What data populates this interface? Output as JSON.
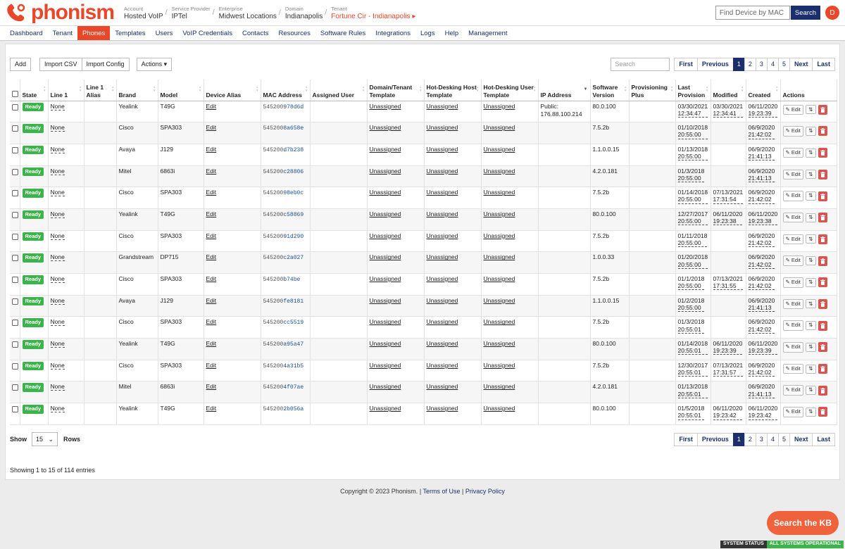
{
  "header": {
    "logo_text": "phonism",
    "crumbs": [
      {
        "label": "Account",
        "value": "Hosted VoIP"
      },
      {
        "label": "Service Provider",
        "value": "IPTel"
      },
      {
        "label": "Enterprise",
        "value": "Midwest Locations"
      },
      {
        "label": "Domain",
        "value": "Indianapolis"
      },
      {
        "label": "Tenant",
        "value": "Fortune Cir - Indianapolis"
      }
    ],
    "mac_placeholder": "Find Device by MAC",
    "search_label": "Search",
    "avatar_letter": "D"
  },
  "nav": [
    "Dashboard",
    "Tenant",
    "Phones",
    "Templates",
    "Users",
    "VoIP Credentials",
    "Contacts",
    "Resources",
    "Software Rules",
    "Integrations",
    "Logs",
    "Help",
    "Management"
  ],
  "toolbar": {
    "add": "Add",
    "import_csv": "Import CSV",
    "import_config": "Import Config",
    "actions": "Actions",
    "search_placeholder": "Search"
  },
  "pager": {
    "first": "First",
    "previous": "Previous",
    "pages": [
      "1",
      "2",
      "3",
      "4",
      "5"
    ],
    "next": "Next",
    "last": "Last"
  },
  "columns": [
    "State",
    "Line 1",
    "Line 1 Alias",
    "Brand",
    "Model",
    "Device Alias",
    "MAC Address",
    "Assigned User",
    "Domain/Tenant Template",
    "Hot-Desking Host Template",
    "Hot-Desking User Template",
    "IP Address",
    "Software Version",
    "Provisioning Plus",
    "Last Provision",
    "Modified",
    "Created",
    "Actions"
  ],
  "rows": [
    {
      "state": "Ready",
      "line1": "None",
      "brand": "Yealink",
      "model": "T49G",
      "alias": "Edit",
      "mac_pre": "545200",
      "mac_post": "978d6d",
      "tmpl": "Unassigned",
      "hd_host": "Unassigned",
      "hd_user": "Unassigned",
      "ip1": "Public:",
      "ip2": "176.88.100.214",
      "sw": "80.0.100",
      "lp_d": "03/30/2021",
      "lp_t": "12:34:47",
      "mod_d": "03/30/2021",
      "mod_t": "12:34:41",
      "cr_d": "06/11/2020",
      "cr_t": "19:23:39"
    },
    {
      "state": "Ready",
      "line1": "None",
      "brand": "Cisco",
      "model": "SPA303",
      "alias": "Edit",
      "mac_pre": "545200",
      "mac_post": "8a658e",
      "tmpl": "Unassigned",
      "hd_host": "Unassigned",
      "hd_user": "Unassigned",
      "ip1": "",
      "ip2": "",
      "sw": "7.5.2b",
      "lp_d": "01/10/2018",
      "lp_t": "20:55:00",
      "mod_d": "",
      "mod_t": "",
      "cr_d": "06/9/2020",
      "cr_t": "21:42:02"
    },
    {
      "state": "Ready",
      "line1": "None",
      "brand": "Avaya",
      "model": "J129",
      "alias": "Edit",
      "mac_pre": "545200",
      "mac_post": "d7b238",
      "tmpl": "Unassigned",
      "hd_host": "Unassigned",
      "hd_user": "Unassigned",
      "ip1": "",
      "ip2": "",
      "sw": "1.1.0.0.15",
      "lp_d": "01/13/2018",
      "lp_t": "20:55:00",
      "mod_d": "",
      "mod_t": "",
      "cr_d": "06/9/2020",
      "cr_t": "21:41:13"
    },
    {
      "state": "Ready",
      "line1": "None",
      "brand": "Mitel",
      "model": "6863i",
      "alias": "Edit",
      "mac_pre": "545200",
      "mac_post": "c28806",
      "tmpl": "Unassigned",
      "hd_host": "Unassigned",
      "hd_user": "Unassigned",
      "ip1": "",
      "ip2": "",
      "sw": "4.2.0.181",
      "lp_d": "01/3/2018",
      "lp_t": "20:55:00",
      "mod_d": "",
      "mod_t": "",
      "cr_d": "06/9/2020",
      "cr_t": "21:41:13"
    },
    {
      "state": "Ready",
      "line1": "None",
      "brand": "Cisco",
      "model": "SPA303",
      "alias": "Edit",
      "mac_pre": "545200",
      "mac_post": "98eb0c",
      "tmpl": "Unassigned",
      "hd_host": "Unassigned",
      "hd_user": "Unassigned",
      "ip1": "",
      "ip2": "",
      "sw": "7.5.2b",
      "lp_d": "01/14/2018",
      "lp_t": "20:55:00",
      "mod_d": "07/13/2021",
      "mod_t": "17:31:54",
      "cr_d": "06/9/2020",
      "cr_t": "21:42:02"
    },
    {
      "state": "Ready",
      "line1": "None",
      "brand": "Yealink",
      "model": "T49G",
      "alias": "Edit",
      "mac_pre": "545200",
      "mac_post": "c58869",
      "tmpl": "Unassigned",
      "hd_host": "Unassigned",
      "hd_user": "Unassigned",
      "ip1": "",
      "ip2": "",
      "sw": "80.0.100",
      "lp_d": "12/27/2017",
      "lp_t": "20:55:00",
      "mod_d": "06/11/2020",
      "mod_t": "19:23:38",
      "cr_d": "06/11/2020",
      "cr_t": "19:23:38"
    },
    {
      "state": "Ready",
      "line1": "None",
      "brand": "Cisco",
      "model": "SPA303",
      "alias": "Edit",
      "mac_pre": "545200",
      "mac_post": "91d290",
      "tmpl": "Unassigned",
      "hd_host": "Unassigned",
      "hd_user": "Unassigned",
      "ip1": "",
      "ip2": "",
      "sw": "7.5.2b",
      "lp_d": "01/11/2018",
      "lp_t": "20:55:00",
      "mod_d": "",
      "mod_t": "",
      "cr_d": "06/9/2020",
      "cr_t": "21:42:02"
    },
    {
      "state": "Ready",
      "line1": "None",
      "brand": "Grandstream",
      "model": "DP715",
      "alias": "Edit",
      "mac_pre": "545200",
      "mac_post": "c2a027",
      "tmpl": "Unassigned",
      "hd_host": "Unassigned",
      "hd_user": "Unassigned",
      "ip1": "",
      "ip2": "",
      "sw": "1.0.0.33",
      "lp_d": "01/20/2018",
      "lp_t": "20:55:00",
      "mod_d": "",
      "mod_t": "",
      "cr_d": "06/9/2020",
      "cr_t": "21:42:02"
    },
    {
      "state": "Ready",
      "line1": "None",
      "brand": "Cisco",
      "model": "SPA303",
      "alias": "Edit",
      "mac_pre": "545200",
      "mac_post": "b74be",
      "tmpl": "Unassigned",
      "hd_host": "Unassigned",
      "hd_user": "Unassigned",
      "ip1": "",
      "ip2": "",
      "sw": "7.5.2b",
      "lp_d": "01/1/2018",
      "lp_t": "20:55:00",
      "mod_d": "07/13/2021",
      "mod_t": "17:31:55",
      "cr_d": "06/9/2020",
      "cr_t": "21:42:02"
    },
    {
      "state": "Ready",
      "line1": "None",
      "brand": "Avaya",
      "model": "J129",
      "alias": "Edit",
      "mac_pre": "545200",
      "mac_post": "fe8181",
      "tmpl": "Unassigned",
      "hd_host": "Unassigned",
      "hd_user": "Unassigned",
      "ip1": "",
      "ip2": "",
      "sw": "1.1.0.0.15",
      "lp_d": "01/2/2018",
      "lp_t": "20:55:00",
      "mod_d": "",
      "mod_t": "",
      "cr_d": "06/9/2020",
      "cr_t": "21:41:13"
    },
    {
      "state": "Ready",
      "line1": "None",
      "brand": "Cisco",
      "model": "SPA303",
      "alias": "Edit",
      "mac_pre": "545200",
      "mac_post": "cc5519",
      "tmpl": "Unassigned",
      "hd_host": "Unassigned",
      "hd_user": "Unassigned",
      "ip1": "",
      "ip2": "",
      "sw": "7.5.2b",
      "lp_d": "01/3/2018",
      "lp_t": "20:55:01",
      "mod_d": "",
      "mod_t": "",
      "cr_d": "06/9/2020",
      "cr_t": "21:42:02"
    },
    {
      "state": "Ready",
      "line1": "None",
      "brand": "Yealink",
      "model": "T49G",
      "alias": "Edit",
      "mac_pre": "545200",
      "mac_post": "a95a47",
      "tmpl": "Unassigned",
      "hd_host": "Unassigned",
      "hd_user": "Unassigned",
      "ip1": "",
      "ip2": "",
      "sw": "80.0.100",
      "lp_d": "01/14/2018",
      "lp_t": "20:55:01",
      "mod_d": "06/11/2020",
      "mod_t": "19:23:39",
      "cr_d": "06/11/2020",
      "cr_t": "19:23:39"
    },
    {
      "state": "Ready",
      "line1": "None",
      "brand": "Cisco",
      "model": "SPA303",
      "alias": "Edit",
      "mac_pre": "545200",
      "mac_post": "4a31b5",
      "tmpl": "Unassigned",
      "hd_host": "Unassigned",
      "hd_user": "Unassigned",
      "ip1": "",
      "ip2": "",
      "sw": "7.5.2b",
      "lp_d": "12/30/2017",
      "lp_t": "20:55:01",
      "mod_d": "07/13/2021",
      "mod_t": "17:31:57",
      "cr_d": "06/9/2020",
      "cr_t": "21:42:02"
    },
    {
      "state": "Ready",
      "line1": "None",
      "brand": "Mitel",
      "model": "6863i",
      "alias": "Edit",
      "mac_pre": "545200",
      "mac_post": "4f07ae",
      "tmpl": "Unassigned",
      "hd_host": "Unassigned",
      "hd_user": "Unassigned",
      "ip1": "",
      "ip2": "",
      "sw": "4.2.0.181",
      "lp_d": "01/13/2018",
      "lp_t": "20:55:01",
      "mod_d": "",
      "mod_t": "",
      "cr_d": "06/9/2020",
      "cr_t": "21:41:13"
    },
    {
      "state": "Ready",
      "line1": "None",
      "brand": "Yealink",
      "model": "T49G",
      "alias": "Edit",
      "mac_pre": "545200",
      "mac_post": "2b056a",
      "tmpl": "Unassigned",
      "hd_host": "Unassigned",
      "hd_user": "Unassigned",
      "ip1": "",
      "ip2": "",
      "sw": "80.0.100",
      "lp_d": "01/5/2018",
      "lp_t": "20:55:01",
      "mod_d": "06/11/2020",
      "mod_t": "19:23:42",
      "cr_d": "06/11/2020",
      "cr_t": "19:23:42"
    }
  ],
  "row_actions": {
    "edit": "Edit"
  },
  "footer_controls": {
    "show": "Show",
    "rows_value": "15",
    "rows": "Rows"
  },
  "info": "Showing 1 to 15 of 114 entries",
  "footer": {
    "copyright": "Copyright © 2023 Phonism.",
    "terms": "Terms of Use",
    "privacy": "Privacy Policy"
  },
  "kb_button": "Search the KB",
  "status": {
    "label": "SYSTEM STATUS",
    "value": "ALL SYSTEMS OPERATIONAL"
  },
  "colors": {
    "brand_orange": "#e8472a",
    "navy": "#1a2f6b",
    "ready_green": "#3cb44b",
    "delete_red": "#d9534f"
  }
}
